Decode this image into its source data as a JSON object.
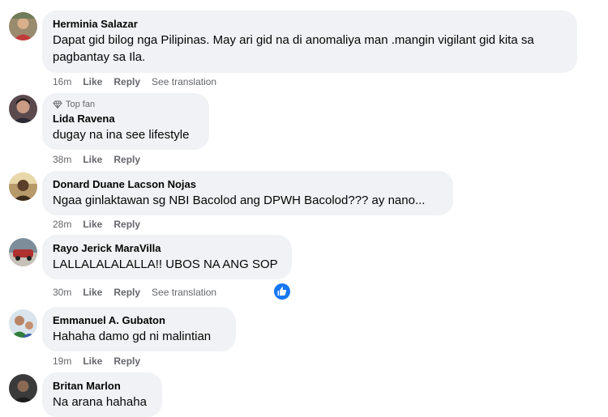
{
  "comments": [
    {
      "author": "Herminia Salazar",
      "text": "Dapat gid bilog nga Pilipinas. May ari gid na di anomaliya man .mangin vigilant gid kita sa pagbantay sa Ila.",
      "time": "16m",
      "like": "Like",
      "reply": "Reply",
      "translate": "See translation"
    },
    {
      "badge": "Top fan",
      "author": "Lida Ravena",
      "text": "dugay na ina see lifestyle",
      "time": "38m",
      "like": "Like",
      "reply": "Reply"
    },
    {
      "author": "Donard Duane Lacson Nojas",
      "text": "Ngaa ginlaktawan sg NBI Bacolod ang DPWH Bacolod??? ay nano...",
      "time": "28m",
      "like": "Like",
      "reply": "Reply"
    },
    {
      "author": "Rayo Jerick MaraVilla",
      "text": "LALLALALALALLA!! UBOS NA ANG SOP",
      "time": "30m",
      "like": "Like",
      "reply": "Reply",
      "translate": "See translation",
      "reaction_icon": "like-reaction-icon"
    },
    {
      "author": "Emmanuel A. Gubaton",
      "text": "Hahaha damo gd ni malintian",
      "time": "19m",
      "like": "Like",
      "reply": "Reply"
    },
    {
      "author": "Britan Marlon",
      "text": "Na arana hahaha"
    }
  ],
  "colors": {
    "bubble": "#f0f2f5",
    "meta": "#65676b",
    "reaction_blue": "#1877f2"
  }
}
